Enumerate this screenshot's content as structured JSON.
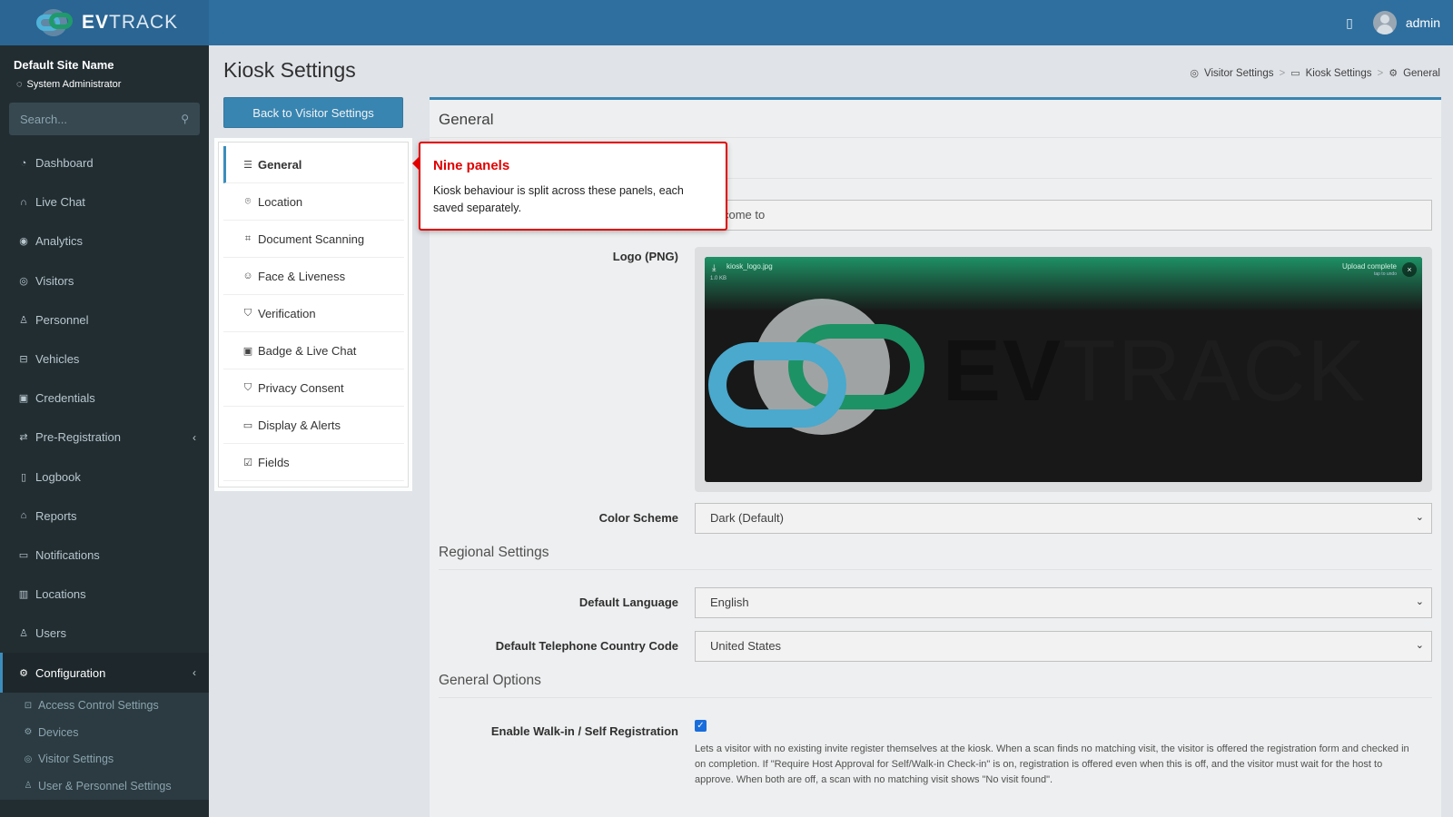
{
  "header": {
    "brand_bold": "EV",
    "brand_light": "TRACK",
    "username": "admin"
  },
  "sidebar": {
    "site_name": "Default Site Name",
    "role": "System Administrator",
    "search_placeholder": "Search...",
    "items": [
      {
        "label": "Dashboard",
        "icon": "dashboard-icon"
      },
      {
        "label": "Live Chat",
        "icon": "headset-icon"
      },
      {
        "label": "Analytics",
        "icon": "analytics-icon"
      },
      {
        "label": "Visitors",
        "icon": "eye-icon"
      },
      {
        "label": "Personnel",
        "icon": "personnel-icon"
      },
      {
        "label": "Vehicles",
        "icon": "car-icon"
      },
      {
        "label": "Credentials",
        "icon": "credentials-icon"
      },
      {
        "label": "Pre-Registration",
        "icon": "exchange-icon"
      },
      {
        "label": "Logbook",
        "icon": "book-icon"
      },
      {
        "label": "Reports",
        "icon": "reports-icon"
      },
      {
        "label": "Notifications",
        "icon": "notifications-icon"
      },
      {
        "label": "Locations",
        "icon": "map-icon"
      },
      {
        "label": "Users",
        "icon": "users-icon"
      },
      {
        "label": "Configuration",
        "icon": "gear-icon"
      }
    ],
    "sub_items": [
      {
        "label": "Access Control Settings",
        "icon": "lock-icon"
      },
      {
        "label": "Devices",
        "icon": "devices-icon"
      },
      {
        "label": "Visitor Settings",
        "icon": "eye-icon"
      },
      {
        "label": "User & Personnel Settings",
        "icon": "user-icon"
      }
    ]
  },
  "page": {
    "title": "Kiosk Settings",
    "back_button": "Back to Visitor Settings",
    "breadcrumb": [
      "Visitor Settings",
      "Kiosk Settings",
      "General"
    ]
  },
  "settings_menu": [
    {
      "label": "General",
      "icon": "sliders-icon"
    },
    {
      "label": "Location",
      "icon": "map-pin-icon"
    },
    {
      "label": "Document Scanning",
      "icon": "scan-icon"
    },
    {
      "label": "Face & Liveness",
      "icon": "face-icon"
    },
    {
      "label": "Verification",
      "icon": "shield-check-icon"
    },
    {
      "label": "Badge & Live Chat",
      "icon": "badge-icon"
    },
    {
      "label": "Privacy Consent",
      "icon": "shield-icon"
    },
    {
      "label": "Display & Alerts",
      "icon": "display-icon"
    },
    {
      "label": "Fields",
      "icon": "checklist-icon"
    }
  ],
  "tooltip": {
    "title": "Nine panels",
    "body": "Kiosk behaviour is split across these panels, each saved separately."
  },
  "panel": {
    "title": "General",
    "welcome_value_visible": "come to",
    "logo_label": "Logo (PNG)",
    "upload": {
      "filename": "kiosk_logo.jpg",
      "filesize": "1.0 KB",
      "status": "Upload complete",
      "tap_text": "tap to undo"
    },
    "color_scheme_label": "Color Scheme",
    "color_scheme_value": "Dark (Default)",
    "regional_section": "Regional Settings",
    "language_label": "Default Language",
    "language_value": "English",
    "country_label": "Default Telephone Country Code",
    "country_value": "United States",
    "general_options_section": "General Options",
    "walkin_label": "Enable Walk-in / Self Registration",
    "walkin_checked": true,
    "walkin_help": "Lets a visitor with no existing invite register themselves at the kiosk. When a scan finds no matching visit, the visitor is offered the registration form and checked in on completion. If \"Require Host Approval for Self/Walk-in Check-in\" is on, registration is offered even when this is off, and the visitor must wait for the host to approve. When both are off, a scan with no matching visit shows \"No visit found\"."
  },
  "colors": {
    "header": "#2f6f9f",
    "sidebar": "#222d32",
    "accent": "#3c8dbc",
    "tooltip_border": "#e00000",
    "brand_green": "#1f9a6b",
    "brand_blue": "#4fb3d9"
  }
}
